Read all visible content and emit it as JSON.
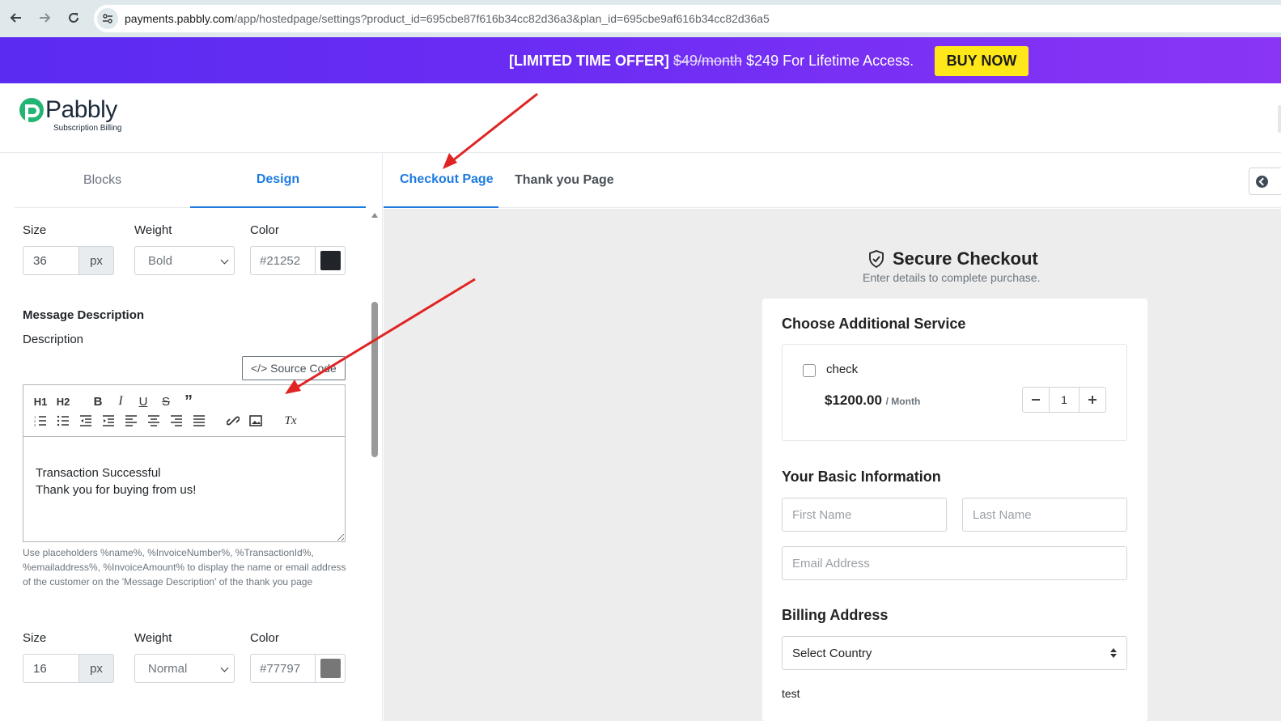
{
  "browser": {
    "url_host": "payments.pabbly.com",
    "url_path": "/app/hostedpage/settings?product_id=695cbe87f616b34cc82d36a3&plan_id=695cbe9af616b34cc82d36a5"
  },
  "promo": {
    "offer_label": "[LIMITED TIME OFFER]",
    "old_price": "$49/month",
    "new_price": "$249 For Lifetime Access.",
    "buy_label": "BUY NOW"
  },
  "logo": {
    "name": "Pabbly",
    "sub": "Subscription Billing"
  },
  "left_tabs": [
    "Blocks",
    "Design"
  ],
  "heading_style": {
    "size_label": "Size",
    "size_value": "36",
    "unit": "px",
    "weight_label": "Weight",
    "weight_value": "Bold",
    "color_label": "Color",
    "color_value": "#21252",
    "swatch": "#212529"
  },
  "message": {
    "section_title": "Message Description",
    "desc_label": "Description",
    "source_code": "</> Source Code",
    "line1": "Transaction Successful",
    "line2": "Thank you for buying from us!",
    "help": "Use placeholders %name%, %InvoiceNumber%, %TransactionId%, %emailaddress%, %InvoiceAmount% to display the name or email address of the customer on the 'Message Description' of the thank you page"
  },
  "toolbar": {
    "h1": "H1",
    "h2": "H2",
    "bold": "B",
    "italic": "I",
    "underline": "U",
    "strike": "S",
    "quote": "”",
    "clear": "Tx"
  },
  "desc_style": {
    "size_label": "Size",
    "size_value": "16",
    "unit": "px",
    "weight_label": "Weight",
    "weight_value": "Normal",
    "color_label": "Color",
    "color_value": "#77797",
    "swatch": "#777777"
  },
  "right_tabs": [
    "Checkout Page",
    "Thank you Page"
  ],
  "checkout": {
    "title": "Secure Checkout",
    "subtitle": "Enter details to complete purchase.",
    "addon_heading": "Choose Additional Service",
    "addon_name": "check",
    "addon_price": "$1200.00",
    "addon_period": "/ Month",
    "qty": "1",
    "basic_heading": "Your Basic Information",
    "first_name_ph": "First Name",
    "last_name_ph": "Last Name",
    "email_ph": "Email Address",
    "billing_heading": "Billing Address",
    "country": "Select Country",
    "extra_label": "test"
  },
  "colors": {
    "accent": "#1d7be0",
    "arrow": "#e02424",
    "buy": "#ffe81a"
  }
}
